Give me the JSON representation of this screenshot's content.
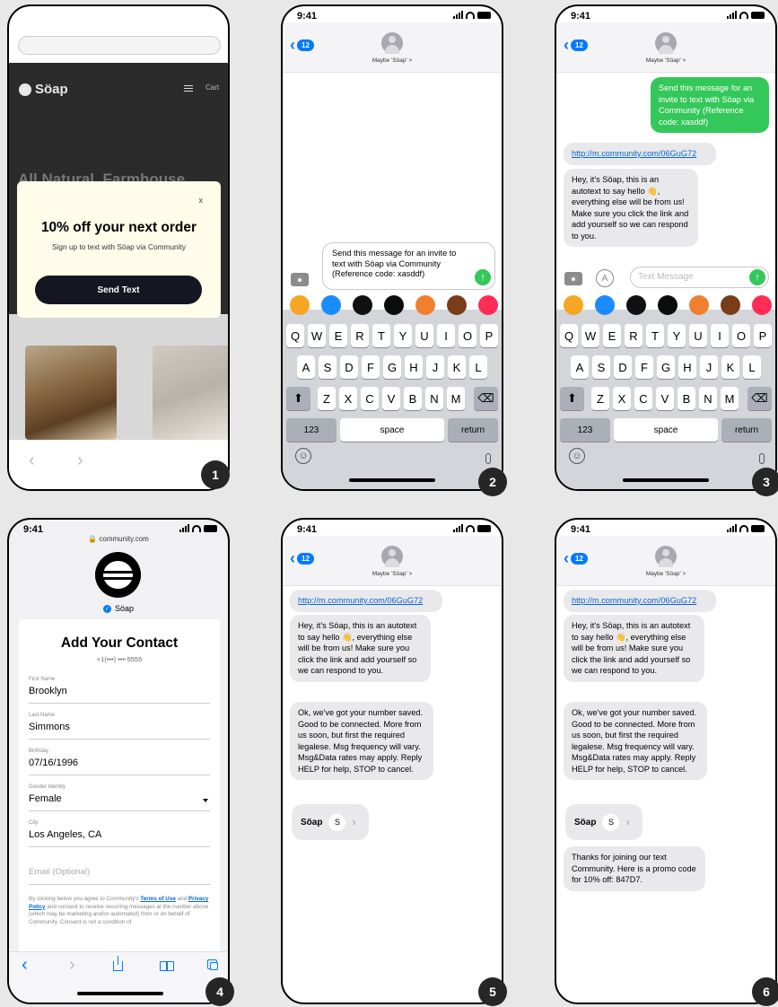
{
  "badges": [
    "1",
    "2",
    "3",
    "4",
    "5",
    "6"
  ],
  "status_time": "9:41",
  "browser": {
    "brand": "Söap",
    "menu_label": "Cart",
    "hero_text": "All Natural, Farmhouse",
    "popup": {
      "close": "x",
      "title": "10% off your next order",
      "subtitle": "Sign up to text with Söap via Community",
      "button": "Send Text"
    }
  },
  "messages": {
    "contact": "Maybe 'Söap' >",
    "back_count": "12",
    "compose_text": "Send this message for an invite to text with Söap via Community (Reference code: xasddf)",
    "sent": "Send this message for an invite to text with Söap via Community (Reference code: xasddf)",
    "link": "http://m.community.com/06GuG72",
    "autotext": "Hey, it's Söap, this is an autotext to say hello 👋, everything else will be from us! Make sure you click the link and add yourself so we can respond to you.",
    "confirm": "Ok, we've got your number saved. Good to be connected. More from us soon, but first the required legalese. Msg frequency will vary. Msg&Data rates may apply. Reply HELP for help, STOP to cancel.",
    "card_name": "Söap",
    "card_initial": "S",
    "promo": "Thanks for joining our text Community. Here is a promo code for 10% off: 847D7.",
    "placeholder": "Text Message"
  },
  "keyboard": {
    "row1": [
      "Q",
      "W",
      "E",
      "R",
      "T",
      "Y",
      "U",
      "I",
      "O",
      "P"
    ],
    "row2": [
      "A",
      "S",
      "D",
      "F",
      "G",
      "H",
      "J",
      "K",
      "L"
    ],
    "row3": [
      "Z",
      "X",
      "C",
      "V",
      "B",
      "N",
      "M"
    ],
    "num": "123",
    "space": "space",
    "ret": "return",
    "shift": "⬆",
    "del": "⌫"
  },
  "form": {
    "domain": "community.com",
    "brand": "Söap",
    "title": "Add Your Contact",
    "phone": "+1(•••) •••-5555",
    "fields": [
      {
        "label": "First Name",
        "value": "Brooklyn"
      },
      {
        "label": "Last Name",
        "value": "Simmons"
      },
      {
        "label": "Birthday",
        "value": "07/16/1996"
      },
      {
        "label": "Gender Identity",
        "value": "Female"
      },
      {
        "label": "City",
        "value": "Los Angeles, CA"
      }
    ],
    "email_placeholder": "Email (Optional)",
    "legal_1": "By clicking below you agree to Community's",
    "terms": "Terms of Use",
    "legal_and": "and",
    "privacy": "Privacy Policy",
    "legal_2": "and consent to receive recurring messages at the number above (which may be marketing and/or automated) from or on behalf of Community. Consent is not a condition of"
  }
}
